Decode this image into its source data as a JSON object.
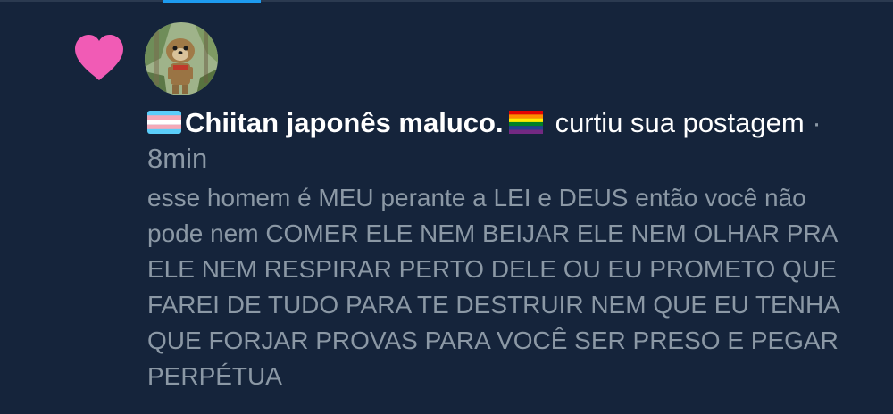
{
  "notification": {
    "icon": "heart-icon",
    "icon_color": "#f15bb5",
    "avatar": "user-avatar",
    "user_prefix_emoji": "transgender-flag",
    "user_name": "Chiitan japonês maluco.",
    "user_suffix_emoji": "rainbow-flag",
    "action_text": "curtiu sua postagem",
    "separator": "·",
    "time": "8min",
    "post_text": "esse homem é MEU perante a LEI e DEUS então você não pode nem COMER ELE NEM BEIJAR ELE NEM OLHAR PRA ELE NEM RESPIRAR PERTO DELE OU EU PROMETO QUE FAREI DE TUDO PARA TE DESTRUIR NEM QUE EU TENHA QUE FORJAR PROVAS PARA VOCÊ SER PRESO E PEGAR PERPÉTUA"
  },
  "colors": {
    "background": "#15243b",
    "primary_text": "#ffffff",
    "secondary_text": "#8b98a5",
    "accent": "#1d9bf0"
  }
}
